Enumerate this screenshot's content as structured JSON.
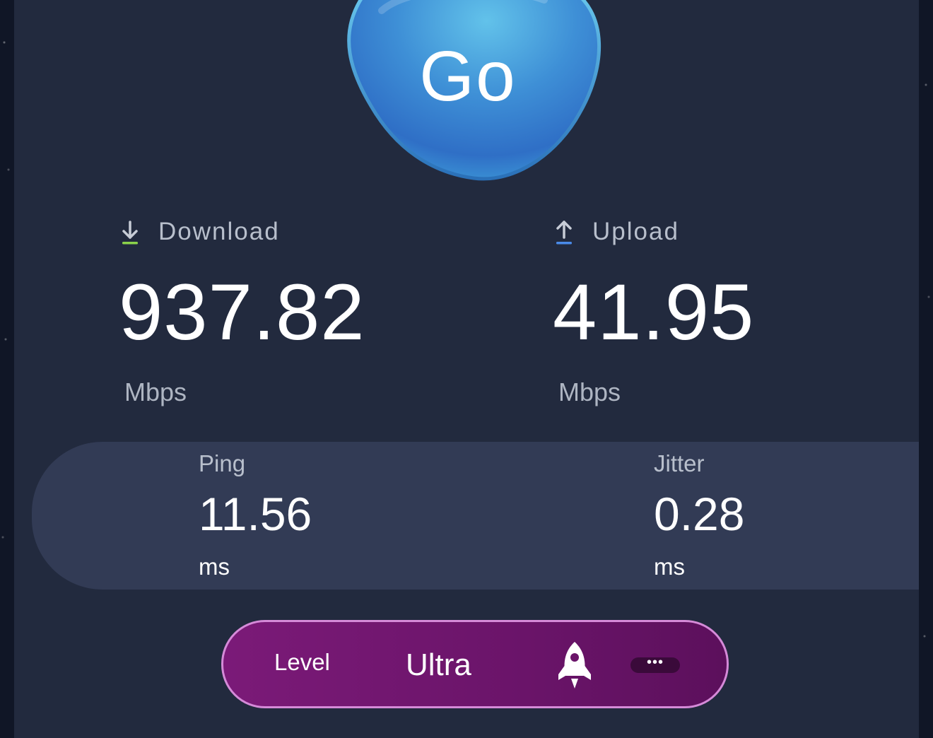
{
  "go_button": {
    "label": "Go"
  },
  "download": {
    "icon": "download-arrow-icon",
    "icon_color": "#8bd24a",
    "title": "Download",
    "value": "937.82",
    "unit": "Mbps"
  },
  "upload": {
    "icon": "upload-arrow-icon",
    "icon_color": "#4a8ae8",
    "title": "Upload",
    "value": "41.95",
    "unit": "Mbps"
  },
  "latency": {
    "ping": {
      "label": "Ping",
      "value": "11.56",
      "unit": "ms"
    },
    "jitter": {
      "label": "Jitter",
      "value": "0.28",
      "unit": "ms"
    }
  },
  "level": {
    "label": "Level",
    "value": "Ultra",
    "icon": "rocket-icon",
    "more_label": "•••"
  },
  "colors": {
    "panel": "#222a3e",
    "latency_bar": "#323b55",
    "level_pill": "#6a1469",
    "level_border": "#d58ad8",
    "go_blue": "#3f8fd8"
  }
}
